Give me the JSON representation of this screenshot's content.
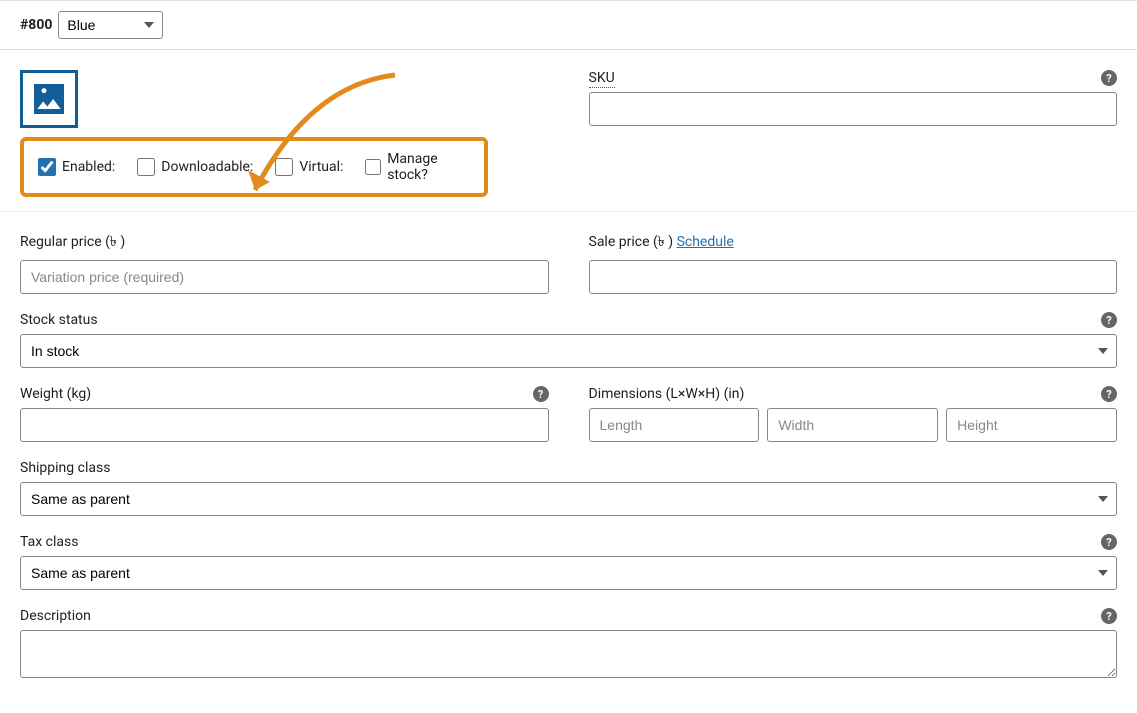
{
  "header": {
    "id": "#800",
    "color_value": "Blue"
  },
  "checkboxes": {
    "enabled": "Enabled:",
    "downloadable": "Downloadable:",
    "virtual": "Virtual:",
    "manage_stock": "Manage stock?"
  },
  "sku": {
    "label": "SKU"
  },
  "regular_price": {
    "label": "Regular price (৳ )",
    "placeholder": "Variation price (required)"
  },
  "sale_price": {
    "label": "Sale price (৳ )",
    "schedule": "Schedule"
  },
  "stock_status": {
    "label": "Stock status",
    "value": "In stock"
  },
  "weight": {
    "label": "Weight (kg)"
  },
  "dimensions": {
    "label": "Dimensions (L×W×H) (in)",
    "length": "Length",
    "width": "Width",
    "height": "Height"
  },
  "shipping_class": {
    "label": "Shipping class",
    "value": "Same as parent"
  },
  "tax_class": {
    "label": "Tax class",
    "value": "Same as parent"
  },
  "description": {
    "label": "Description"
  }
}
